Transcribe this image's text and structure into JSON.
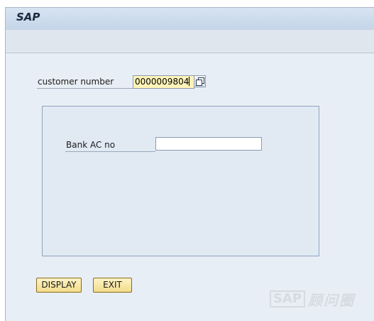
{
  "window": {
    "title": "SAP"
  },
  "form": {
    "customer_number": {
      "label": "customer number",
      "value": "0000009804"
    },
    "bank_ac_no": {
      "label": "Bank AC no",
      "value": ""
    }
  },
  "buttons": {
    "display_label": "DISPLAY",
    "exit_label": "EXIT"
  },
  "watermark": {
    "logo_text": "SAP",
    "suffix": "顾问圈"
  },
  "colors": {
    "title_bar": "#c4d5e8",
    "content_bg": "#e8eef5",
    "required_field_bg": "#fff3b8",
    "button_bg": "#f2dc8c"
  },
  "icons": {
    "value_help": "f4-help-icon"
  }
}
